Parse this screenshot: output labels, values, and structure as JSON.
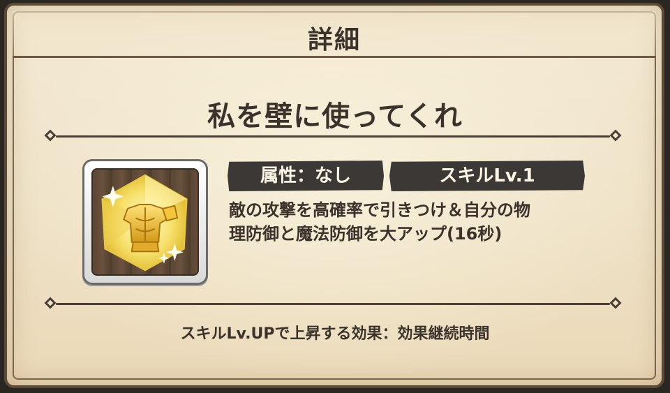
{
  "header": {
    "title": "詳細"
  },
  "skill": {
    "name": "私を壁に使ってくれ",
    "attribute_tag": "属性：なし",
    "level_tag": "スキルLv.1",
    "description_line1": "敵の攻撃を高確率で引きつけ＆自分の物",
    "description_line2": "理防御と魔法防御を大アップ(16秒)",
    "icon": "golden-armor-crystal-icon"
  },
  "footer": {
    "level_up_effect": "スキルLv.UPで上昇する効果：効果継続時間"
  },
  "colors": {
    "parchment": "#efe3c8",
    "frame": "#5b4a38",
    "text": "#3b332b",
    "tag_bg": "#3c3835",
    "icon_gold": "#f6d43a"
  }
}
